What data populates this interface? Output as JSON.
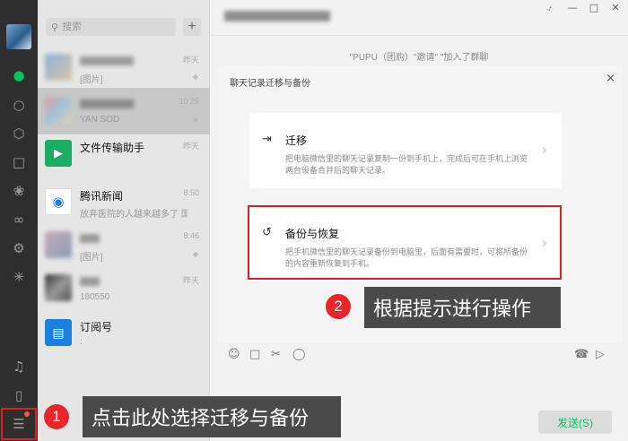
{
  "rail": {
    "icons": [
      "chat-icon",
      "contacts-icon",
      "favorites-icon",
      "folder-icon",
      "moments-icon",
      "channels-icon",
      "mini-programs-icon",
      "discover-icon",
      "music-icon",
      "phone-icon",
      "menu-icon"
    ],
    "accent": "#07c160"
  },
  "search": {
    "placeholder": "搜索",
    "add_label": "+"
  },
  "chats": [
    {
      "name": "",
      "preview": "[图片]",
      "time": "昨天"
    },
    {
      "name": "",
      "preview": "YAN SOD  ",
      "time": "10:25"
    },
    {
      "name": "文件传输助手",
      "preview": "",
      "time": "昨天"
    },
    {
      "name": "腾讯新闻",
      "preview": "放弃医院的人越来越多了 国...",
      "time": "8:50"
    },
    {
      "name": "",
      "preview": "[图片]",
      "time": "8:46"
    },
    {
      "name": "",
      "preview": "180550",
      "time": "昨天"
    },
    {
      "name": "订阅号",
      "preview": ":",
      "time": ""
    }
  ],
  "main": {
    "system_message": "\"PUPU（团购）\"邀请\"  \"加入了群聊",
    "overlay_title": "聊天记录迁移与备份",
    "close_label": "×",
    "cards": [
      {
        "title": "迁移",
        "desc": "把电脑微信里的聊天记录复制一份到手机上，完成后可在手机上浏览两台设备合并后的聊天记录。"
      },
      {
        "title": "备份与恢复",
        "desc": "把手机微信里的聊天记录备份到电脑里，后面有需要时，可将所备份的内容重新恢复到手机。"
      }
    ],
    "send_label": "发送(S)"
  },
  "callouts": [
    {
      "number": "1",
      "text": "点击此处选择迁移与备份"
    },
    {
      "number": "2",
      "text": "根据提示进行操作"
    }
  ],
  "colors": {
    "highlight": "#e02020",
    "badge": "#e8262a",
    "callout_bg": "#4a4a4a",
    "send_text": "#07c160"
  }
}
